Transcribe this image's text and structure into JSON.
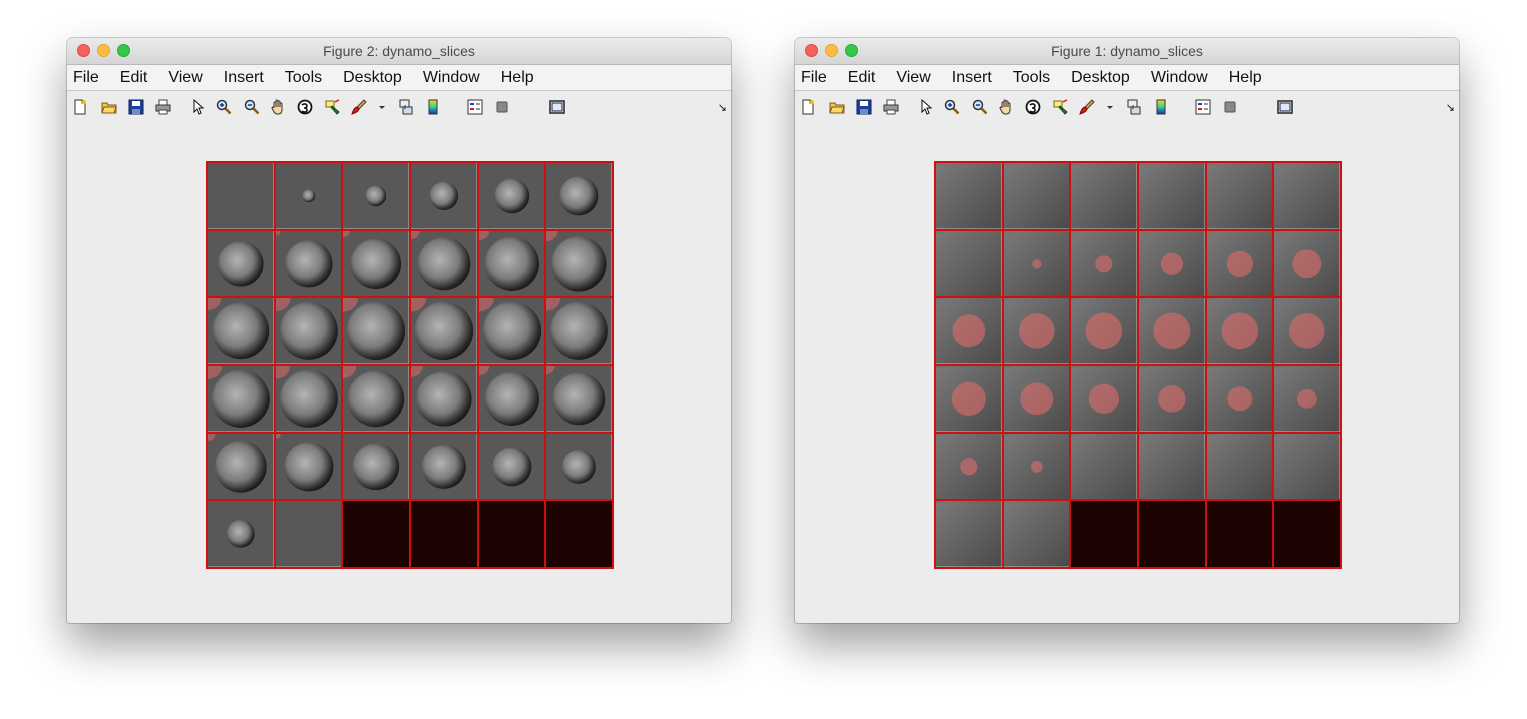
{
  "menu": [
    "File",
    "Edit",
    "View",
    "Insert",
    "Tools",
    "Desktop",
    "Window",
    "Help"
  ],
  "toolbar_icons": [
    "new-figure-icon",
    "open-file-icon",
    "save-icon",
    "print-icon",
    "edit-plot-arrow-icon",
    "zoom-in-icon",
    "zoom-out-icon",
    "pan-hand-icon",
    "rotate-3d-icon",
    "data-cursor-icon",
    "brush-icon",
    "brush-dropdown-icon",
    "link-plot-icon",
    "colorbar-icon",
    "legend-icon",
    "hide-plot-tools-icon",
    "show-plot-tools-icon"
  ],
  "colors": {
    "grid_line": "#d01010",
    "empty_tile": "#1e0303",
    "mask_overlay": "#e06a6a"
  },
  "windows": [
    {
      "id": "figure-2",
      "title": "Figure 2: dynamo_slices",
      "mode": "sphere",
      "tiles": [
        {
          "s": 0,
          "m": 0
        },
        {
          "s": 0.2,
          "m": 0
        },
        {
          "s": 0.33,
          "m": 0
        },
        {
          "s": 0.45,
          "m": 0
        },
        {
          "s": 0.55,
          "m": 0
        },
        {
          "s": 0.62,
          "m": 0
        },
        {
          "s": 0.72,
          "m": 0
        },
        {
          "s": 0.75,
          "m": 0.15
        },
        {
          "s": 0.8,
          "m": 0.22
        },
        {
          "s": 0.84,
          "m": 0.28
        },
        {
          "s": 0.86,
          "m": 0.32
        },
        {
          "s": 0.88,
          "m": 0.36
        },
        {
          "s": 0.9,
          "m": 0.42
        },
        {
          "s": 0.92,
          "m": 0.46
        },
        {
          "s": 0.93,
          "m": 0.48
        },
        {
          "s": 0.93,
          "m": 0.48
        },
        {
          "s": 0.93,
          "m": 0.47
        },
        {
          "s": 0.92,
          "m": 0.45
        },
        {
          "s": 0.92,
          "m": 0.45
        },
        {
          "s": 0.92,
          "m": 0.44
        },
        {
          "s": 0.9,
          "m": 0.42
        },
        {
          "s": 0.88,
          "m": 0.38
        },
        {
          "s": 0.86,
          "m": 0.32
        },
        {
          "s": 0.84,
          "m": 0.28
        },
        {
          "s": 0.82,
          "m": 0.24
        },
        {
          "s": 0.78,
          "m": 0.16
        },
        {
          "s": 0.74,
          "m": 0
        },
        {
          "s": 0.7,
          "m": 0
        },
        {
          "s": 0.62,
          "m": 0
        },
        {
          "s": 0.54,
          "m": 0
        },
        {
          "s": 0.44,
          "m": 0
        },
        {
          "s": 0,
          "m": 0
        },
        "empty",
        "empty",
        "empty",
        "empty"
      ]
    },
    {
      "id": "figure-1",
      "title": "Figure 1: dynamo_slices",
      "mode": "texture",
      "tiles": [
        {
          "m": 0
        },
        {
          "m": 0
        },
        {
          "m": 0
        },
        {
          "m": 0
        },
        {
          "m": 0
        },
        {
          "m": 0
        },
        {
          "m": 0
        },
        {
          "m": 0.14
        },
        {
          "m": 0.26
        },
        {
          "m": 0.34
        },
        {
          "m": 0.4
        },
        {
          "m": 0.44
        },
        {
          "m": 0.5
        },
        {
          "m": 0.54
        },
        {
          "m": 0.56
        },
        {
          "m": 0.56
        },
        {
          "m": 0.56
        },
        {
          "m": 0.54
        },
        {
          "m": 0.52
        },
        {
          "m": 0.5
        },
        {
          "m": 0.46
        },
        {
          "m": 0.42
        },
        {
          "m": 0.38
        },
        {
          "m": 0.3
        },
        {
          "m": 0.26
        },
        {
          "m": 0.18
        },
        {
          "m": 0
        },
        {
          "m": 0
        },
        {
          "m": 0
        },
        {
          "m": 0
        },
        {
          "m": 0
        },
        {
          "m": 0
        },
        "empty",
        "empty",
        "empty",
        "empty"
      ]
    }
  ]
}
